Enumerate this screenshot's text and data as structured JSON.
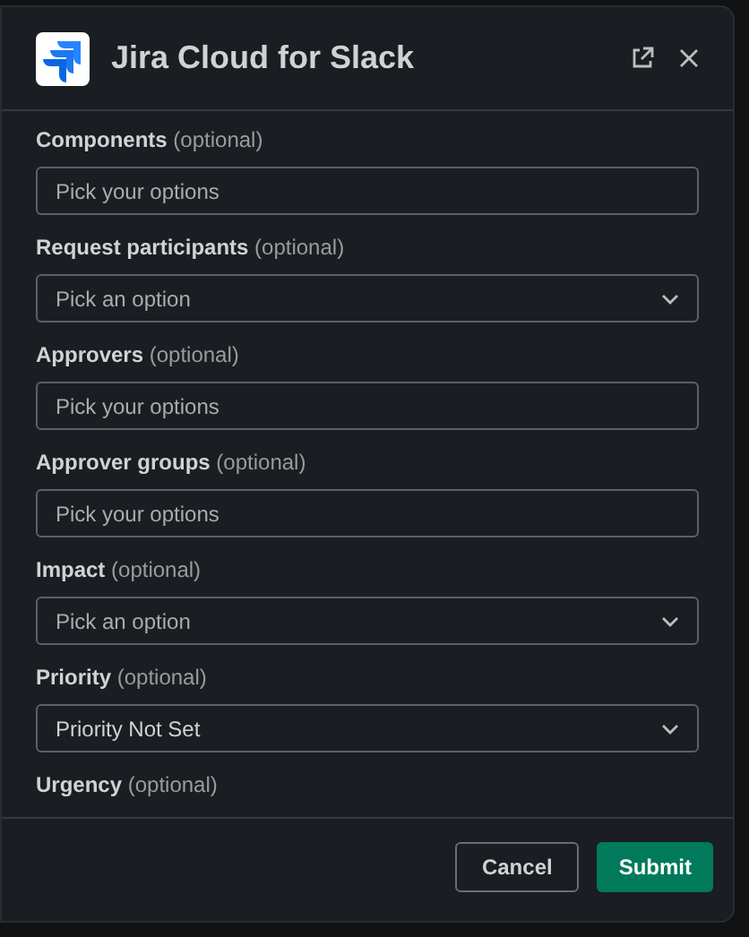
{
  "modal": {
    "title": "Jira Cloud for Slack"
  },
  "fields": [
    {
      "label": "Components",
      "hint": "(optional)",
      "kind": "multi",
      "placeholder": "Pick your options"
    },
    {
      "label": "Request participants",
      "hint": "(optional)",
      "kind": "select",
      "placeholder": "Pick an option"
    },
    {
      "label": "Approvers",
      "hint": "(optional)",
      "kind": "multi",
      "placeholder": "Pick your options"
    },
    {
      "label": "Approver groups",
      "hint": "(optional)",
      "kind": "multi",
      "placeholder": "Pick your options"
    },
    {
      "label": "Impact",
      "hint": "(optional)",
      "kind": "select",
      "placeholder": "Pick an option"
    },
    {
      "label": "Priority",
      "hint": "(optional)",
      "kind": "select",
      "value": "Priority Not Set"
    },
    {
      "label": "Urgency",
      "hint": "(optional)",
      "kind": "label"
    }
  ],
  "buttons": [
    {
      "label": "Cancel",
      "kind": "secondary"
    },
    {
      "label": "Submit",
      "kind": "primary"
    }
  ]
}
